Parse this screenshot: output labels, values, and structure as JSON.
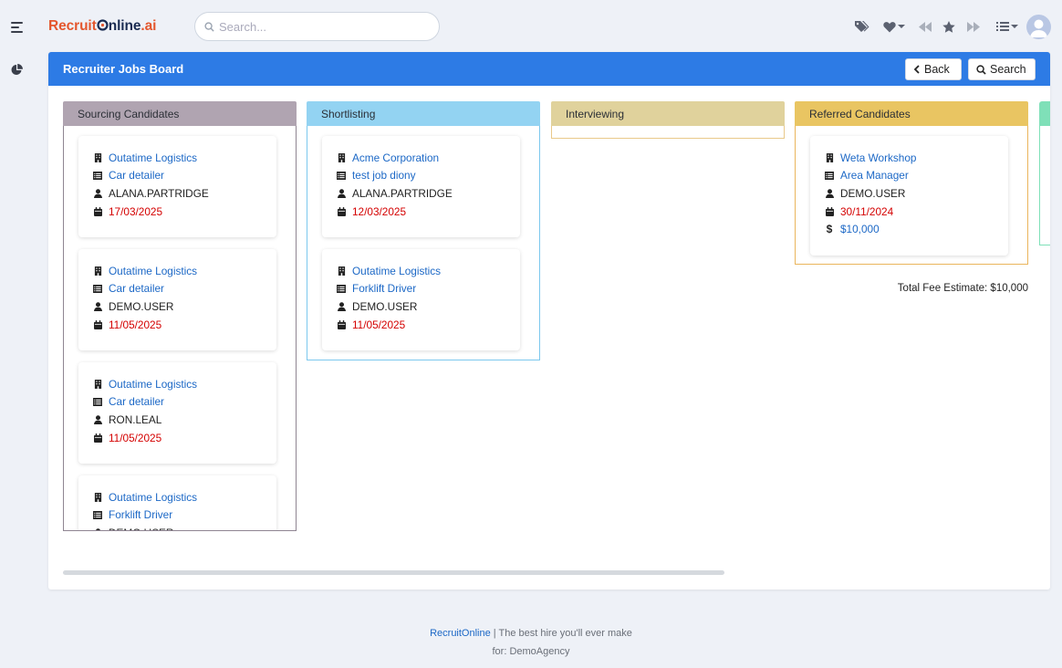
{
  "app": {
    "logo": {
      "part1": "Recruit",
      "part2": "nline",
      "part3": ".ai"
    },
    "search_placeholder": "Search..."
  },
  "board": {
    "title": "Recruiter Jobs Board",
    "back_label": "Back",
    "search_label": "Search",
    "total_fee_estimate": "Total Fee Estimate: $10,000"
  },
  "columns": [
    {
      "name": "Sourcing Candidates",
      "header_color": "#b0a4b1",
      "border_color": "#8f8592",
      "cards": [
        {
          "company": "Outatime Logistics",
          "job": "Car detailer",
          "user": "ALANA.PARTRIDGE",
          "date": "17/03/2025"
        },
        {
          "company": "Outatime Logistics",
          "job": "Car detailer",
          "user": "DEMO.USER",
          "date": "11/05/2025"
        },
        {
          "company": "Outatime Logistics",
          "job": "Car detailer",
          "user": "RON.LEAL",
          "date": "11/05/2025"
        },
        {
          "company": "Outatime Logistics",
          "job": "Forklift Driver",
          "user": "DEMO.USER",
          "date": ""
        }
      ]
    },
    {
      "name": "Shortlisting",
      "header_color": "#93d3f2",
      "border_color": "#7cc8ee",
      "cards": [
        {
          "company": "Acme Corporation",
          "job": "test job diony",
          "user": "ALANA.PARTRIDGE",
          "date": "12/03/2025"
        },
        {
          "company": "Outatime Logistics",
          "job": "Forklift Driver",
          "user": "DEMO.USER",
          "date": "11/05/2025"
        }
      ]
    },
    {
      "name": "Interviewing",
      "header_color": "#e0d29c",
      "border_color": "#e9c98a",
      "cards": []
    },
    {
      "name": "Referred Candidates",
      "header_color": "#e9c562",
      "border_color": "#eab55c",
      "cards": [
        {
          "company": "Weta Workshop",
          "job": "Area Manager",
          "user": "DEMO.USER",
          "date": "30/11/2024",
          "fee": "$10,000"
        }
      ]
    }
  ],
  "footer": {
    "brand": "RecruitOnline",
    "tagline": "| The best hire you'll ever make",
    "agency": "for: DemoAgency"
  }
}
